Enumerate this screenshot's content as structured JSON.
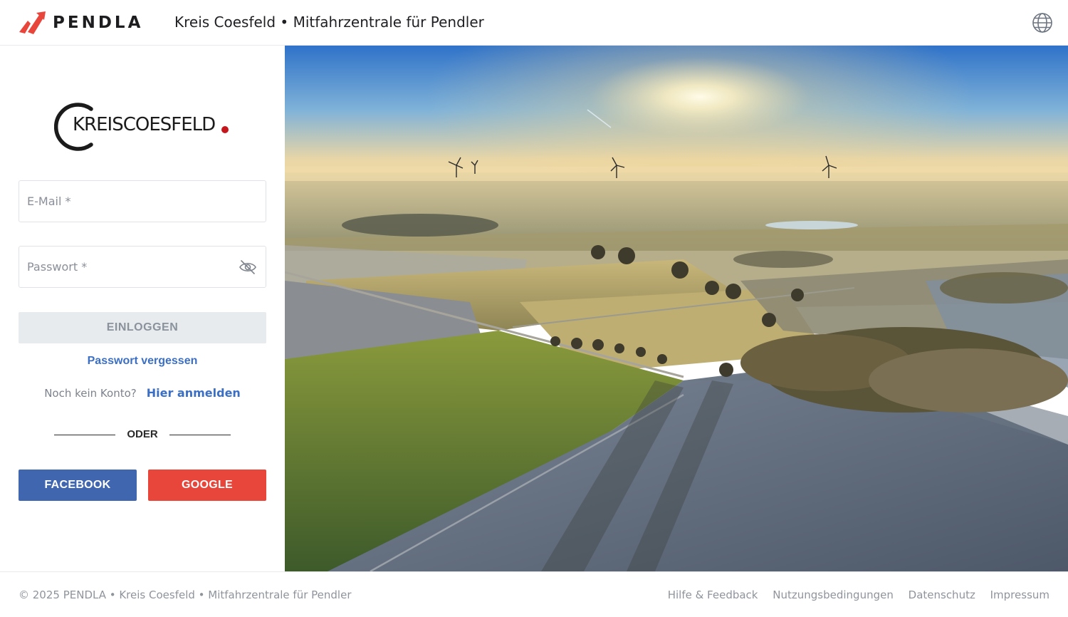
{
  "header": {
    "brand": "PENDLA",
    "app_title": "Kreis Coesfeld • Mitfahrzentrale für Pendler",
    "language_icon": "globe-icon"
  },
  "logo": {
    "part1": "KREIS",
    "part2": "COESFELD",
    "dot_color": "#c4161c"
  },
  "login_form": {
    "email_placeholder": "E-Mail *",
    "email_value": "",
    "password_placeholder": "Passwort *",
    "password_value": "",
    "password_toggle_icon": "eye-off-icon",
    "submit_label": "EINLOGGEN",
    "forgot_password": "Passwort vergessen",
    "no_account_text": "Noch kein Konto?",
    "register_link": "Hier anmelden",
    "divider_text": "ODER"
  },
  "social_login": {
    "facebook_label": "FACEBOOK",
    "google_label": "GOOGLE",
    "facebook_color": "#4166b0",
    "google_color": "#e8453b"
  },
  "footer": {
    "copyright": "© 2025 PENDLA • Kreis Coesfeld • Mitfahrzentrale für Pendler",
    "links": [
      "Hilfe & Feedback",
      "Nutzungsbedingungen",
      "Datenschutz",
      "Impressum"
    ]
  },
  "colors": {
    "accent_link": "#3b6fc4",
    "brand_red": "#e8453b"
  }
}
